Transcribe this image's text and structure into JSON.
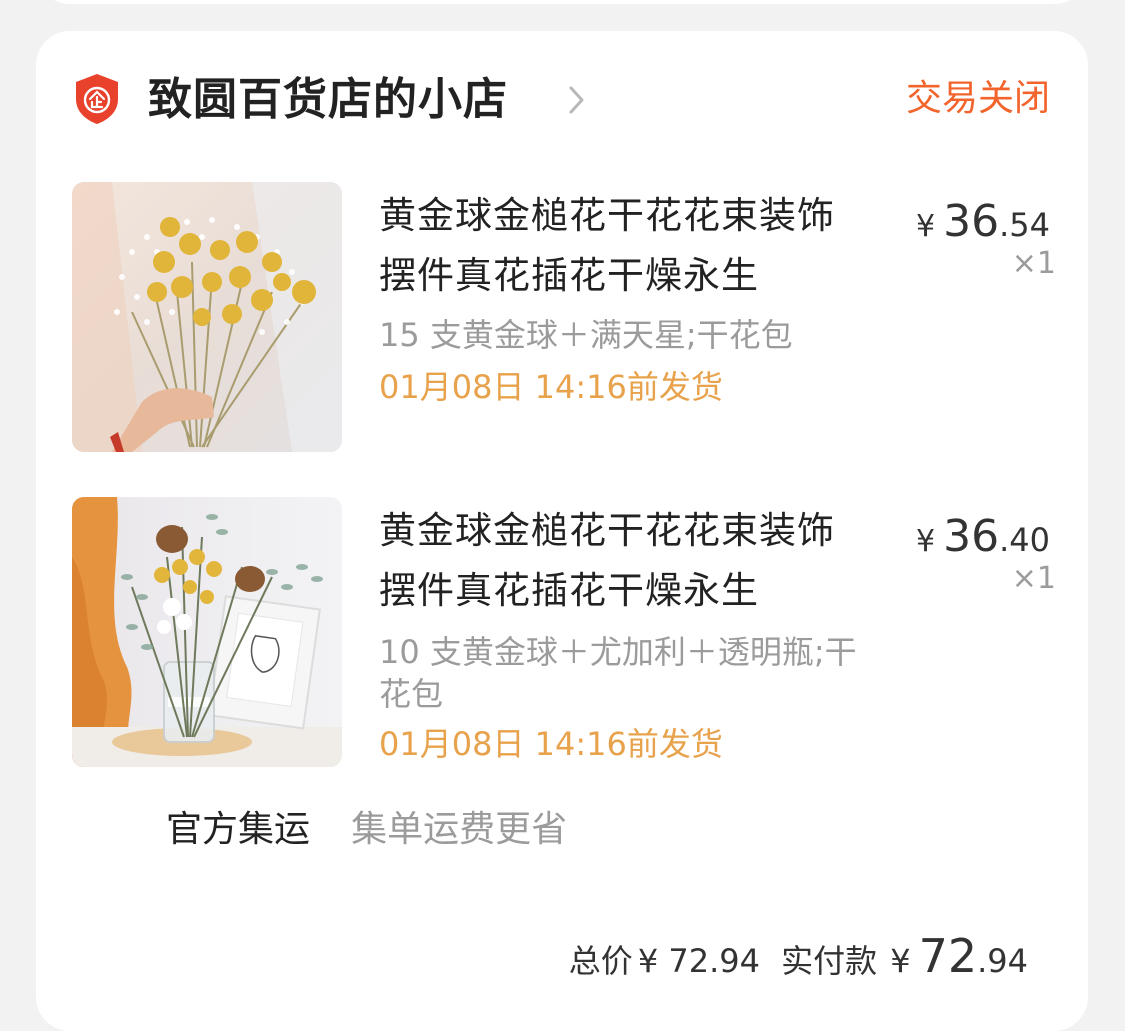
{
  "shop": {
    "name": "致圆百货店的小店",
    "status": "交易关闭"
  },
  "items": [
    {
      "title": "黄金球金槌花干花花束装饰摆件真花插花干燥永生",
      "spec": "15 支黄金球＋满天星;干花包",
      "ship": "01月08日 14:16前发货",
      "price_symbol": "¥",
      "price_int": "36",
      "price_dec": ".54",
      "qty": "×1"
    },
    {
      "title": "黄金球金槌花干花花束装饰摆件真花插花干燥永生",
      "spec": "10 支黄金球＋尤加利＋透明瓶;干花包",
      "ship": "01月08日 14:16前发货",
      "price_symbol": "¥",
      "price_int": "36",
      "price_dec": ".40",
      "qty": "×1"
    }
  ],
  "shipping": {
    "label": "官方集运",
    "desc": "集单运费更省"
  },
  "totals": {
    "total_label": "总价",
    "total_value": "¥ 72.94",
    "paid_label": "实付款",
    "paid_symbol": "¥",
    "paid_int": "72",
    "paid_dec": ".94"
  },
  "colors": {
    "status": "#f2642b",
    "ship_time": "#e8a24b",
    "shield": "#e8412c"
  },
  "icons": {
    "shop_badge": "enterprise-shield-icon",
    "chevron": "chevron-right-icon"
  }
}
